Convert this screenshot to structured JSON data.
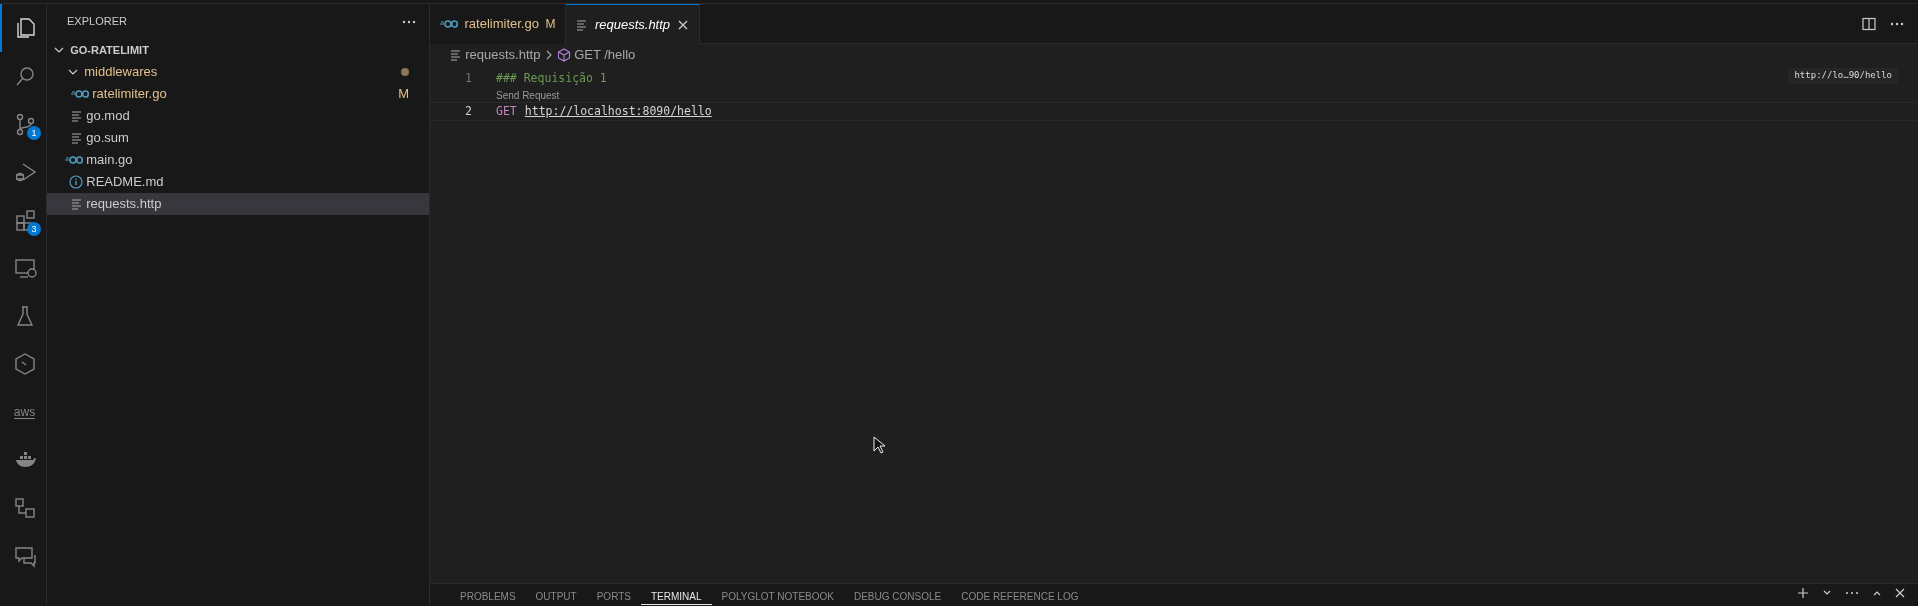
{
  "activity_bar": {
    "items": [
      {
        "kind": "files",
        "selected": true
      },
      {
        "kind": "search",
        "selected": false
      },
      {
        "kind": "source-control",
        "selected": false,
        "badge": "1"
      },
      {
        "kind": "run-debug",
        "selected": false
      },
      {
        "kind": "extensions",
        "selected": false,
        "badge": "3"
      },
      {
        "kind": "remote",
        "selected": false
      },
      {
        "kind": "testing",
        "selected": false
      },
      {
        "kind": "hexagon",
        "selected": false
      },
      {
        "kind": "aws",
        "selected": false,
        "label": "aws"
      },
      {
        "kind": "docker",
        "selected": false
      },
      {
        "kind": "flow",
        "selected": false
      },
      {
        "kind": "chat",
        "selected": false
      }
    ]
  },
  "explorer": {
    "title": "EXPLORER",
    "project": {
      "name": "GO-RATELIMIT",
      "expanded": true,
      "children": [
        {
          "name": "middlewares",
          "kind": "folder",
          "expanded": true,
          "modified": true,
          "selected": false,
          "children": [
            {
              "name": "ratelimiter.go",
              "kind": "go",
              "modified": true,
              "status": "M",
              "selected": false
            }
          ]
        },
        {
          "name": "go.mod",
          "kind": "text",
          "modified": false,
          "selected": false
        },
        {
          "name": "go.sum",
          "kind": "text",
          "modified": false,
          "selected": false
        },
        {
          "name": "main.go",
          "kind": "go",
          "modified": false,
          "selected": false
        },
        {
          "name": "README.md",
          "kind": "info",
          "modified": false,
          "selected": false
        },
        {
          "name": "requests.http",
          "kind": "text",
          "modified": false,
          "selected": true
        }
      ]
    }
  },
  "tabs": [
    {
      "label": "ratelimiter.go",
      "kind": "go",
      "status": "M",
      "modified": true,
      "preview": false,
      "selected": false
    },
    {
      "label": "requests.http",
      "kind": "text",
      "modified": false,
      "preview": true,
      "selected": true
    }
  ],
  "breadcrumb": [
    {
      "text": "requests.http",
      "kind": "text"
    },
    {
      "text": "GET /hello",
      "kind": "symbol"
    }
  ],
  "editor": {
    "lines": [
      {
        "number": "1",
        "current": false,
        "tokens": [
          {
            "text": "### Requisição 1",
            "kind": "comment"
          }
        ]
      },
      {
        "number": "2",
        "current": true,
        "codelens": "Send Request",
        "tokens": [
          {
            "text": "GET",
            "kind": "keyword"
          },
          {
            "text": "http://localhost:8090/hello",
            "kind": "url"
          }
        ]
      }
    ],
    "minimap_hover": "http://lo…90/hello"
  },
  "panel": {
    "tabs": [
      {
        "label": "PROBLEMS",
        "selected": false
      },
      {
        "label": "OUTPUT",
        "selected": false
      },
      {
        "label": "PORTS",
        "selected": false
      },
      {
        "label": "TERMINAL",
        "selected": true
      },
      {
        "label": "POLYGLOT NOTEBOOK",
        "selected": false
      },
      {
        "label": "DEBUG CONSOLE",
        "selected": false
      },
      {
        "label": "CODE REFERENCE LOG",
        "selected": false
      }
    ]
  }
}
